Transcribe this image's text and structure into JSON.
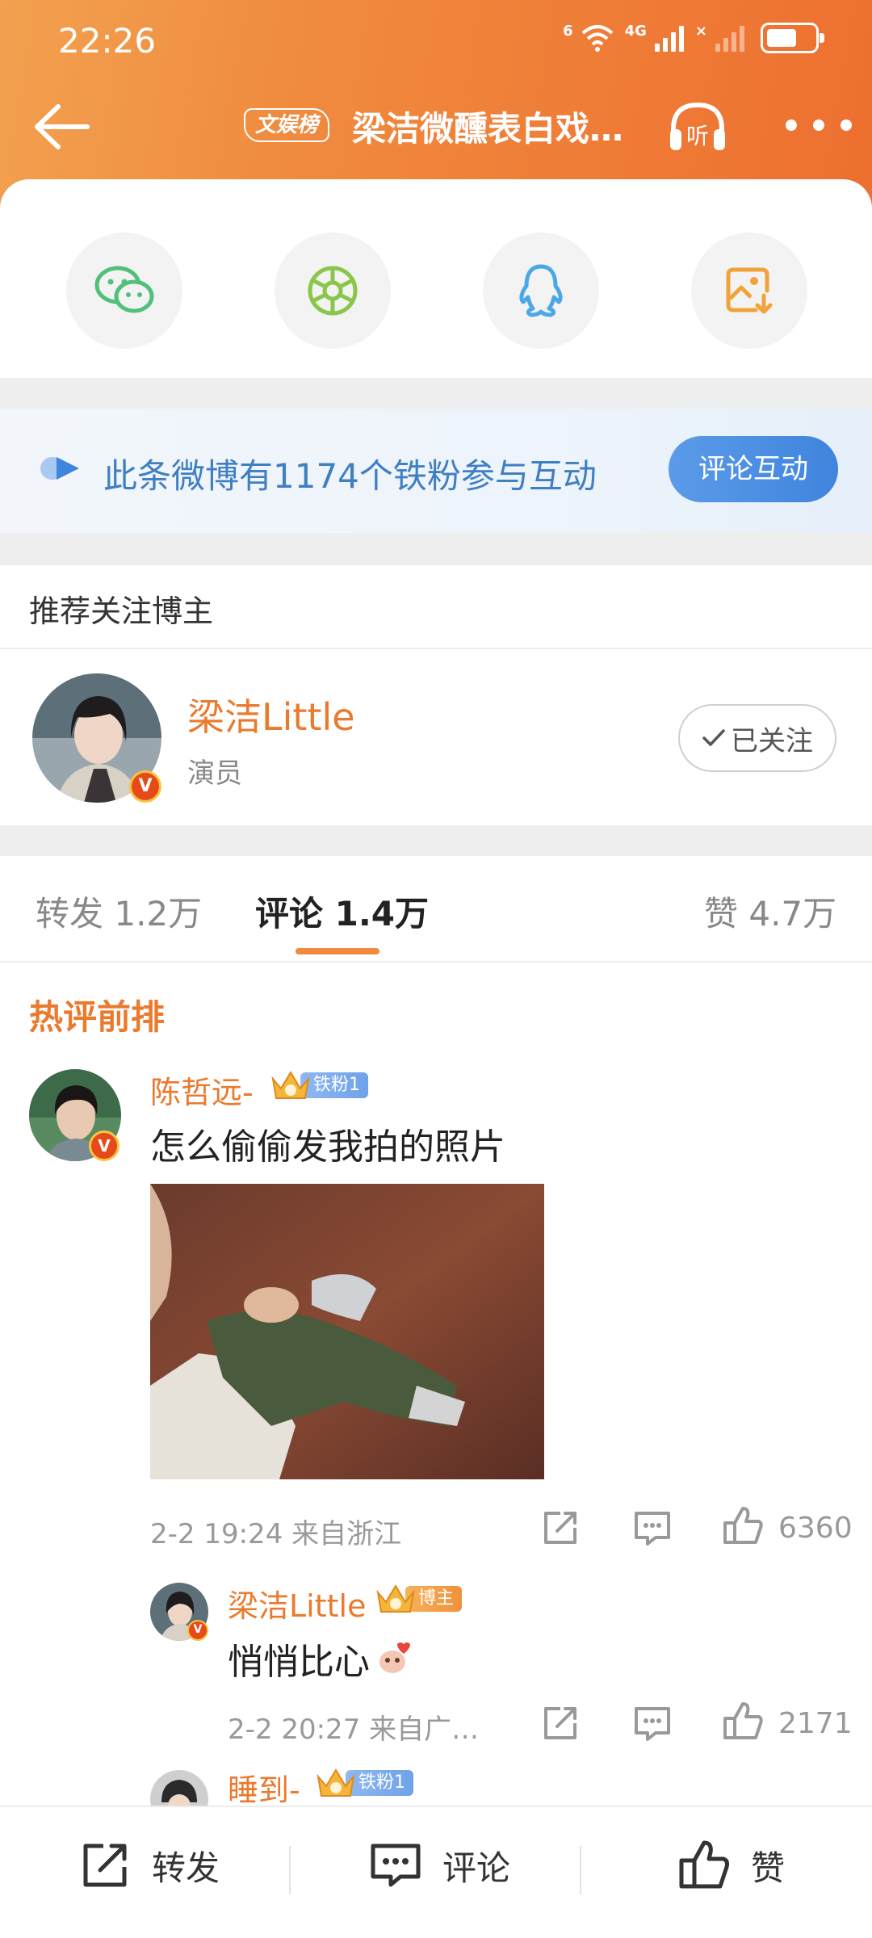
{
  "status_bar": {
    "time": "22:26",
    "network_label_1": "6",
    "network_label_2": "4G",
    "network_label_3": "×"
  },
  "header": {
    "badge": "文娱榜",
    "title": "梁洁微醺表白戏…",
    "listen_label": "听",
    "icons": [
      "back-arrow-icon",
      "headphones-icon",
      "more-dots-icon"
    ]
  },
  "share": {
    "items": [
      {
        "name": "wechat-icon",
        "color": "#52c07a"
      },
      {
        "name": "moments-icon",
        "color": "#8ac64a"
      },
      {
        "name": "qq-icon",
        "color": "#4aa8e8"
      },
      {
        "name": "save-image-icon",
        "color": "#f0a33a"
      }
    ]
  },
  "fan_banner": {
    "text": "此条微博有1174个铁粉参与互动",
    "button": "评论互动"
  },
  "recommend": {
    "title": "推荐关注博主",
    "name": "梁洁Little",
    "role": "演员",
    "badge": "V",
    "follow_label": "已关注"
  },
  "tabs": {
    "repost": "转发 1.2万",
    "comment": "评论 1.4万",
    "like": "赞 4.7万",
    "active": "comment"
  },
  "comments": {
    "section_title": "热评前排",
    "items": [
      {
        "user": "陈哲远-",
        "badge": "铁粉1",
        "vbadge": "V",
        "text": "怎么偷偷发我拍的照片",
        "meta": "2-2 19:24 来自浙江",
        "likes": "6360"
      },
      {
        "user": "梁洁Little",
        "badge": "博主",
        "vbadge": "V",
        "text": "悄悄比心",
        "meta": "2-2 20:27 来自广…",
        "likes": "2171"
      },
      {
        "user": "睡到-",
        "badge": "铁粉1"
      }
    ]
  },
  "bottom_bar": {
    "repost": "转发",
    "comment": "评论",
    "like": "赞"
  },
  "colors": {
    "brand_orange": "#ee6f30",
    "username_orange": "#ea7a2e",
    "fan_blue": "#3f84de"
  }
}
